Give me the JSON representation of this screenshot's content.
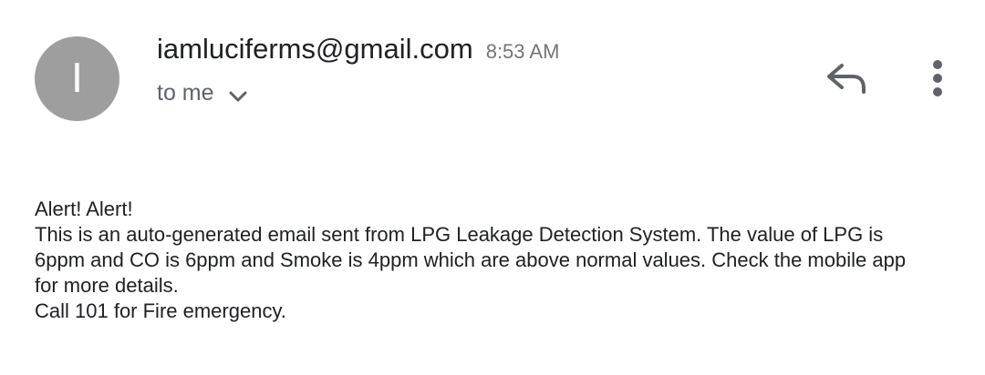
{
  "email": {
    "avatar_letter": "I",
    "avatar_color": "#9e9e9e",
    "sender": "iamluciferms@gmail.com",
    "time": "8:53 AM",
    "recipient_label": "to me",
    "body_lines": [
      "Alert! Alert!",
      "This is an auto-generated email sent from LPG Leakage Detection System. The value of LPG is",
      "6ppm and CO is 6ppm and Smoke is 4ppm which are above normal values. Check the mobile app",
      "for more details.",
      "Call 101 for Fire emergency."
    ]
  },
  "icons": {
    "details_toggle": "chevron-down-icon",
    "reply": "reply-icon",
    "more": "more-vert-icon"
  }
}
